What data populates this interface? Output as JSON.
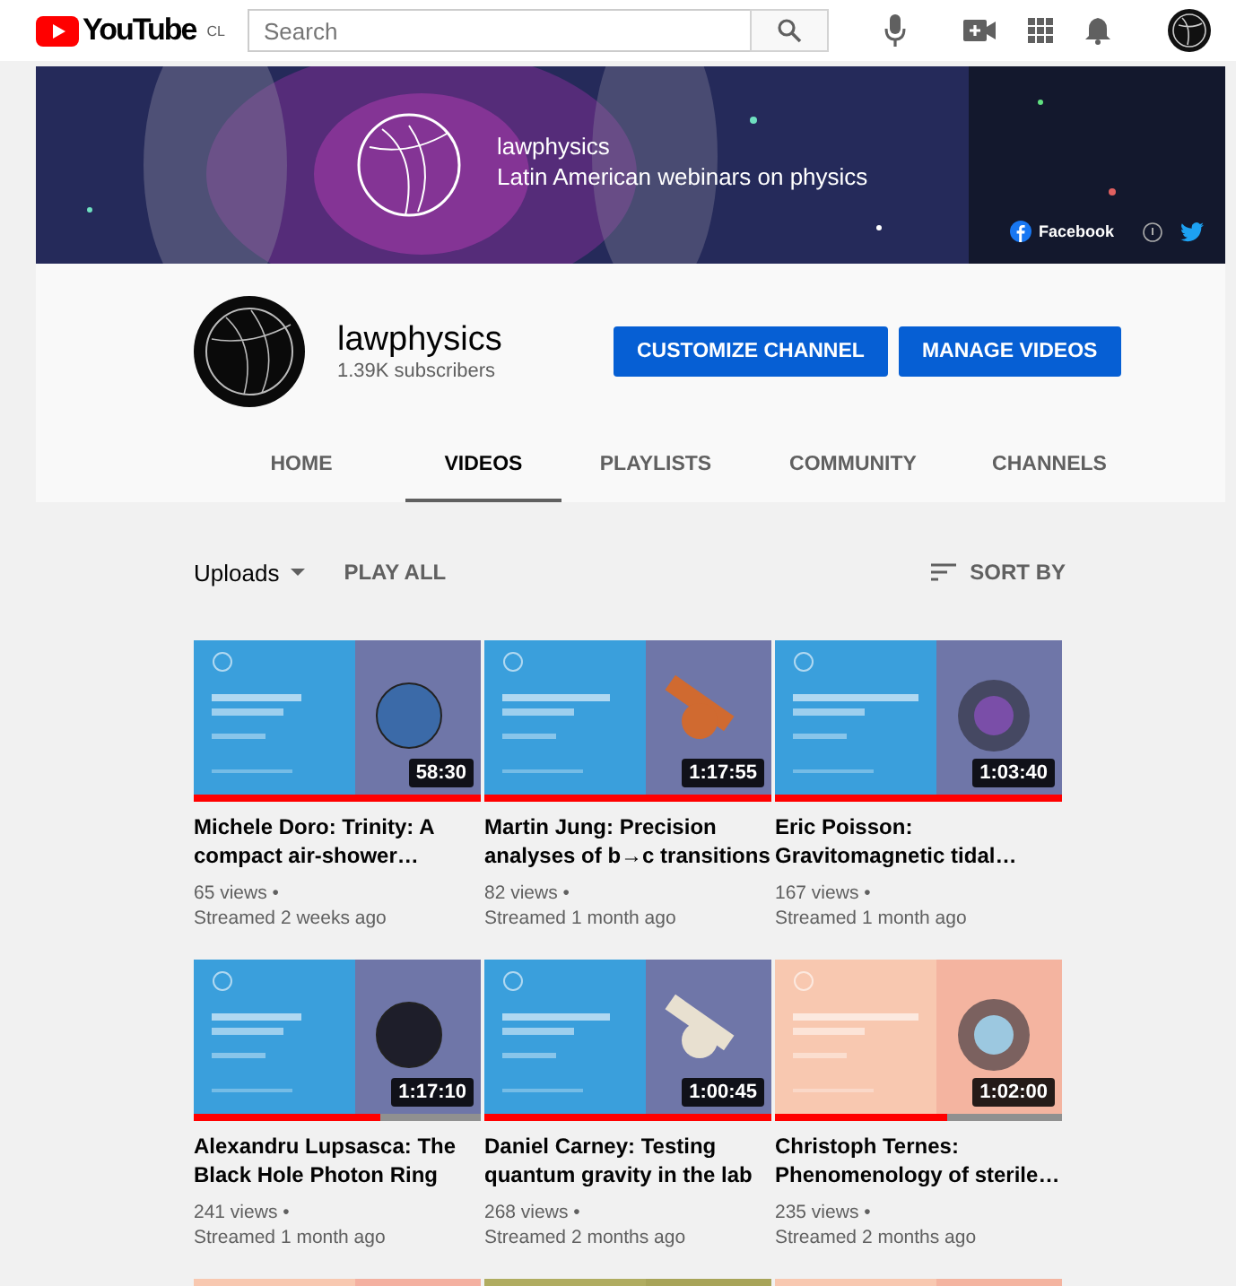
{
  "topbar": {
    "logo": "YouTube",
    "country": "CL",
    "search": {
      "placeholder": "Search"
    }
  },
  "banner": {
    "title": "lawphysics",
    "subtitle": "Latin American webinars on physics",
    "links": [
      {
        "kind": "facebook",
        "label": "Facebook"
      },
      {
        "kind": "website"
      },
      {
        "kind": "twitter"
      }
    ]
  },
  "channel": {
    "name": "lawphysics",
    "subscribers": "1.39K subscribers",
    "buttons": [
      "CUSTOMIZE CHANNEL",
      "MANAGE VIDEOS"
    ]
  },
  "tabs": [
    {
      "label": "HOME",
      "selected": false
    },
    {
      "label": "VIDEOS",
      "selected": true
    },
    {
      "label": "PLAYLISTS",
      "selected": false
    },
    {
      "label": "COMMUNITY",
      "selected": false
    },
    {
      "label": "CHANNELS",
      "selected": false
    }
  ],
  "toolbar": {
    "uploads": "Uploads",
    "play_all": "PLAY ALL",
    "sort": "SORT BY"
  },
  "videos": [
    {
      "thumbnail": {
        "kind": "picture"
      },
      "duration": "58:30",
      "level": 1,
      "title": "Michele Doro: Trinity: A compact air-shower…",
      "views": "65 views •",
      "date": "Streamed 2 weeks ago"
    },
    {
      "thumbnail": {
        "kind": "picture"
      },
      "duration": "1:17:55",
      "level": 1,
      "title": "Martin Jung: Precision analyses of b→c transitions",
      "views": "82 views •",
      "date": "Streamed 1 month ago"
    },
    {
      "thumbnail": {
        "kind": "picture"
      },
      "duration": "1:03:40",
      "level": 1,
      "title": "Eric Poisson: Gravitomagnetic tidal…",
      "views": "167 views •",
      "date": "Streamed 1 month ago"
    },
    {
      "thumbnail": {
        "kind": "picture"
      },
      "duration": "1:17:10",
      "level": 0.65,
      "title": "Alexandru Lupsasca: The Black Hole Photon Ring",
      "views": "241 views •",
      "date": "Streamed 1 month ago"
    },
    {
      "thumbnail": {
        "kind": "picture"
      },
      "duration": "1:00:45",
      "level": 1,
      "title": "Daniel Carney: Testing quantum gravity in the lab",
      "views": "268 views •",
      "date": "Streamed 2 months ago"
    },
    {
      "thumbnail": {
        "kind": "picture"
      },
      "duration": "1:02:00",
      "level": 0.6,
      "title": "Christoph Ternes: Phenomenology of sterile…",
      "views": "235 views •",
      "date": "Streamed 2 months ago"
    },
    {
      "thumbnail": {
        "kind": "picture"
      }
    },
    {
      "thumbnail": {
        "kind": "picture"
      }
    },
    {
      "thumbnail": {
        "kind": "picture"
      }
    }
  ]
}
